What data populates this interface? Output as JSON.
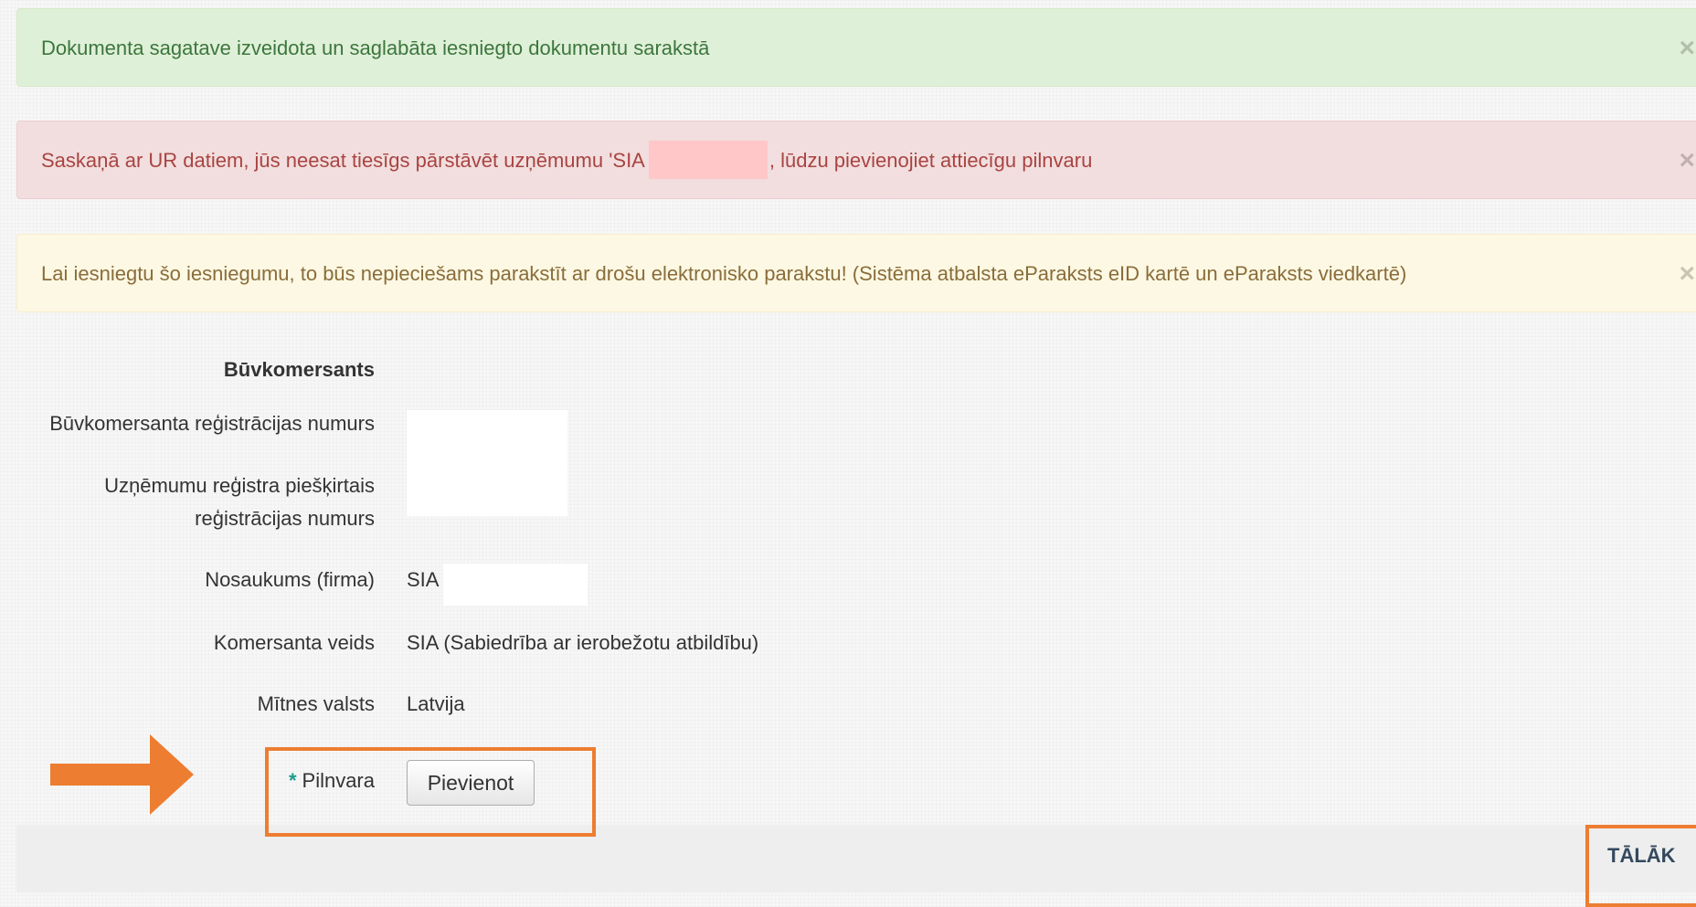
{
  "alerts": {
    "success": "Dokumenta sagatave izveidota un saglabāta iesniegto dokumentu sarakstā",
    "danger_before": "Saskaņā ar UR datiem, jūs neesat tiesīgs pārstāvēt uzņēmumu 'SIA",
    "danger_after": ", lūdzu pievienojiet attiecīgu pilnvaru",
    "warning": "Lai iesniegtu šo iesniegumu, to būs nepieciešams parakstīt ar drošu elektronisko parakstu! (Sistēma atbalsta eParaksts eID kartē un eParaksts viedkartē)",
    "close_symbol": "×"
  },
  "form": {
    "section_title": "Būvkomersants",
    "reg_number_label": "Būvkomersanta reģistrācijas numurs",
    "ur_number_label_line1": "Uzņēmumu reģistra piešķirtais",
    "ur_number_label_line2": "reģistrācijas numurs",
    "name_label": "Nosaukums (firma)",
    "name_value": "SIA",
    "type_label": "Komersanta veids",
    "type_value": "SIA (Sabiedrība ar ierobežotu atbildību)",
    "country_label": "Mītnes valsts",
    "country_value": "Latvija",
    "required_marker": "*",
    "authorization_label": "Pilnvara",
    "add_button": "Pievienot"
  },
  "footer": {
    "next_label": "TĀLĀK"
  },
  "colors": {
    "annotation": "#ed7d31",
    "success_bg": "#dff0d8",
    "danger_bg": "#f2dede",
    "warning_bg": "#fcf8e3"
  }
}
